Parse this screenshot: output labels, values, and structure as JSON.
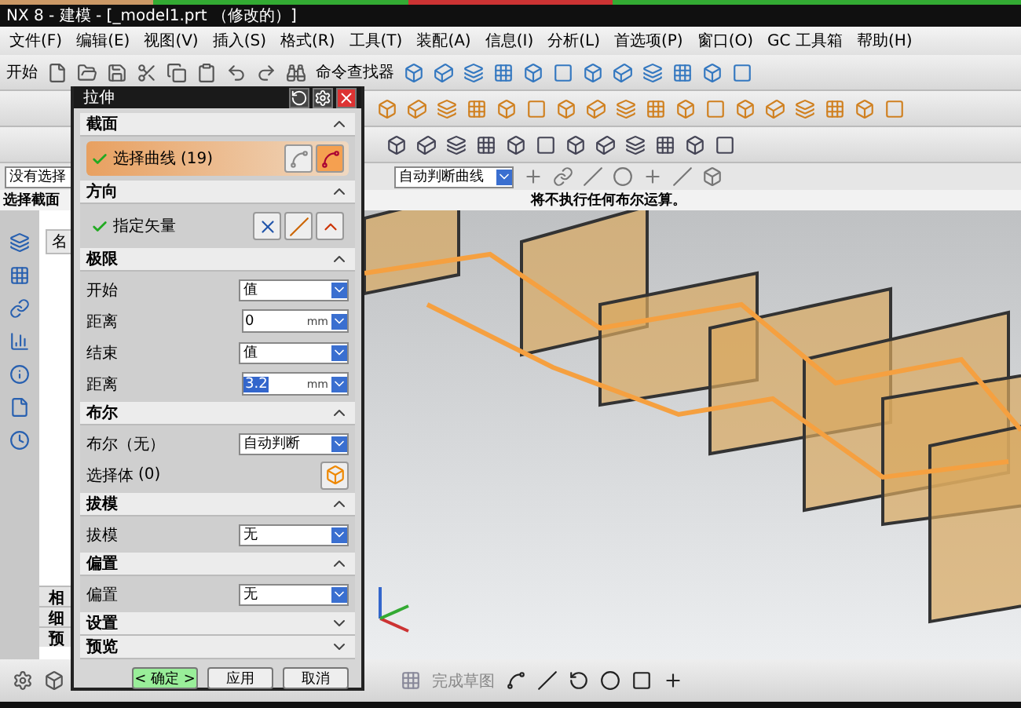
{
  "window": {
    "title": "NX 8 - 建模 - [_model1.prt （修改的）]"
  },
  "menu": [
    "文件(F)",
    "编辑(E)",
    "视图(V)",
    "插入(S)",
    "格式(R)",
    "工具(T)",
    "装配(A)",
    "信息(I)",
    "分析(L)",
    "首选项(P)",
    "窗口(O)",
    "GC 工具箱",
    "帮助(H)"
  ],
  "toolbar": {
    "start": "开始",
    "command_finder": "命令查找器"
  },
  "selection_bar": {
    "filter": "没有选择",
    "curve_rule": "自动判断曲线"
  },
  "cue_line": {
    "prompt": "选择截面",
    "status": "将不执行任何布尔运算。"
  },
  "navigator": {
    "column": "名",
    "panels": [
      "相",
      "细",
      "预"
    ]
  },
  "dialog": {
    "title": "拉伸",
    "sections": [
      {
        "title": "截面",
        "expanded": true,
        "rows": [
          {
            "kind": "select",
            "label": "选择曲线",
            "count": "(19)",
            "checked": true,
            "active": true
          }
        ]
      },
      {
        "title": "方向",
        "expanded": true,
        "rows": [
          {
            "kind": "vector",
            "label": "指定矢量",
            "checked": true,
            "active": false
          }
        ]
      },
      {
        "title": "极限",
        "expanded": true,
        "rows": [
          {
            "kind": "dropdown",
            "label": "开始",
            "value": "值"
          },
          {
            "kind": "distance",
            "label": "距离",
            "value": "0",
            "unit": "mm",
            "selected": false
          },
          {
            "kind": "dropdown",
            "label": "结束",
            "value": "值"
          },
          {
            "kind": "distance",
            "label": "距离",
            "value": "3.2",
            "unit": "mm",
            "selected": true
          }
        ]
      },
      {
        "title": "布尔",
        "expanded": true,
        "rows": [
          {
            "kind": "dropdown",
            "label": "布尔（无）",
            "value": "自动判断"
          },
          {
            "kind": "body",
            "label": "选择体",
            "count": "(0)"
          }
        ]
      },
      {
        "title": "拔模",
        "expanded": true,
        "rows": [
          {
            "kind": "dropdown",
            "label": "拔模",
            "value": "无"
          }
        ]
      },
      {
        "title": "偏置",
        "expanded": true,
        "rows": [
          {
            "kind": "dropdown",
            "label": "偏置",
            "value": "无"
          }
        ]
      },
      {
        "title": "设置",
        "expanded": false
      },
      {
        "title": "预览",
        "expanded": false
      }
    ],
    "buttons": [
      {
        "label": "< 确定 >",
        "primary": true
      },
      {
        "label": "应用",
        "primary": false
      },
      {
        "label": "取消",
        "primary": false
      }
    ]
  },
  "sketch_toolbar": {
    "finish": "完成草图"
  }
}
